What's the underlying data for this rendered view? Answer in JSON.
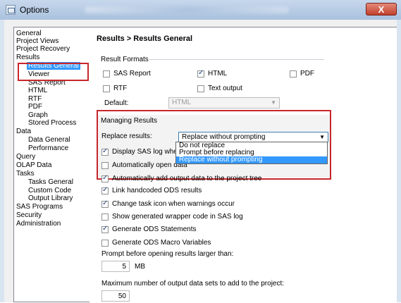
{
  "window": {
    "title": "Options",
    "close_label": "X"
  },
  "nav": {
    "items": [
      "General",
      "Project Views",
      "Project Recovery",
      "Results",
      "Results General",
      "Viewer",
      "SAS Report",
      "HTML",
      "RTF",
      "PDF",
      "Graph",
      "Stored Process",
      "Data",
      "Data General",
      "Performance",
      "Query",
      "OLAP Data",
      "Tasks",
      "Tasks General",
      "Custom Code",
      "Output Library",
      "SAS Programs",
      "Security",
      "Administration"
    ],
    "selected": "Results General"
  },
  "panel": {
    "title": "Results > Results General",
    "result_formats": {
      "label": "Result Formats",
      "sas_report": {
        "label": "SAS Report",
        "checked": false
      },
      "html": {
        "label": "HTML",
        "checked": true
      },
      "pdf": {
        "label": "PDF",
        "checked": false
      },
      "rtf": {
        "label": "RTF",
        "checked": false
      },
      "text_output": {
        "label": "Text output",
        "checked": false
      },
      "default_label": "Default:",
      "default_value": "HTML"
    },
    "managing": {
      "label": "Managing Results",
      "replace_label": "Replace results:",
      "replace_value": "Replace without prompting",
      "options": [
        "Do not replace",
        "Prompt before replacing",
        "Replace without prompting"
      ],
      "selected_option": "Replace without prompting"
    },
    "checkboxes": [
      {
        "label": "Display SAS log when er",
        "checked": true
      },
      {
        "label": "Automatically open data",
        "checked": false
      },
      {
        "label": "Automatically add output data to the project tree",
        "checked": true
      },
      {
        "label": "Link handcoded ODS results",
        "checked": true
      },
      {
        "label": "Change task icon when warnings occur",
        "checked": true
      },
      {
        "label": "Show generated wrapper code in SAS log",
        "checked": false
      },
      {
        "label": "Generate ODS Statements",
        "checked": true
      },
      {
        "label": "Generate ODS Macro Variables",
        "checked": false
      }
    ],
    "prompt_label": "Prompt before opening results larger than:",
    "prompt_value": "5",
    "prompt_unit": "MB",
    "max_label": "Maximum number of output data sets to add to the project:",
    "max_value": "50"
  }
}
